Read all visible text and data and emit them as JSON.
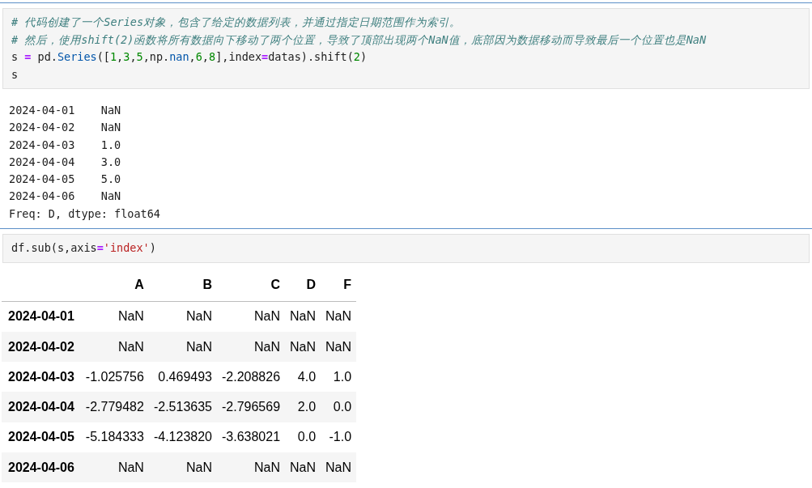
{
  "cells": [
    {
      "input": {
        "lines": [
          [
            {
              "kind": "comment",
              "text": "# 代码创建了一个Series对象，包含了给定的数据列表，并通过指定日期范围作为索引。"
            }
          ],
          [
            {
              "kind": "comment",
              "text": "# 然后，使用shift(2)函数将所有数据向下移动了两个位置，导致了顶部出现两个NaN值，底部因为数据移动而导致最后一个位置也是NaN"
            }
          ],
          [
            {
              "kind": "text",
              "text": "s "
            },
            {
              "kind": "operator",
              "text": "="
            },
            {
              "kind": "text",
              "text": " pd."
            },
            {
              "kind": "name",
              "text": "Series"
            },
            {
              "kind": "text",
              "text": "(["
            },
            {
              "kind": "number",
              "text": "1"
            },
            {
              "kind": "text",
              "text": ","
            },
            {
              "kind": "number",
              "text": "3"
            },
            {
              "kind": "text",
              "text": ","
            },
            {
              "kind": "number",
              "text": "5"
            },
            {
              "kind": "text",
              "text": ",np."
            },
            {
              "kind": "name",
              "text": "nan"
            },
            {
              "kind": "text",
              "text": ","
            },
            {
              "kind": "number",
              "text": "6"
            },
            {
              "kind": "text",
              "text": ","
            },
            {
              "kind": "number",
              "text": "8"
            },
            {
              "kind": "text",
              "text": "],index"
            },
            {
              "kind": "operator",
              "text": "="
            },
            {
              "kind": "text",
              "text": "datas).shift("
            },
            {
              "kind": "number",
              "text": "2"
            },
            {
              "kind": "text",
              "text": ")"
            }
          ],
          [
            {
              "kind": "text",
              "text": "s"
            }
          ]
        ]
      },
      "output": {
        "kind": "stream",
        "lines": [
          "2024-04-01    NaN",
          "2024-04-02    NaN",
          "2024-04-03    1.0",
          "2024-04-04    3.0",
          "2024-04-05    5.0",
          "2024-04-06    NaN",
          "Freq: D, dtype: float64"
        ]
      }
    },
    {
      "input": {
        "lines": [
          [
            {
              "kind": "text",
              "text": "df.sub(s,axis"
            },
            {
              "kind": "operator",
              "text": "="
            },
            {
              "kind": "string",
              "text": "'index'"
            },
            {
              "kind": "text",
              "text": ")"
            }
          ]
        ]
      },
      "output": {
        "kind": "table",
        "columns": [
          "A",
          "B",
          "C",
          "D",
          "F"
        ],
        "rows": [
          {
            "index": "2024-04-01",
            "values": [
              "NaN",
              "NaN",
              "NaN",
              "NaN",
              "NaN"
            ]
          },
          {
            "index": "2024-04-02",
            "values": [
              "NaN",
              "NaN",
              "NaN",
              "NaN",
              "NaN"
            ]
          },
          {
            "index": "2024-04-03",
            "values": [
              "-1.025756",
              "0.469493",
              "-2.208826",
              "4.0",
              "1.0"
            ]
          },
          {
            "index": "2024-04-04",
            "values": [
              "-2.779482",
              "-2.513635",
              "-2.796569",
              "2.0",
              "0.0"
            ]
          },
          {
            "index": "2024-04-05",
            "values": [
              "-5.184333",
              "-4.123820",
              "-3.638021",
              "0.0",
              "-1.0"
            ]
          },
          {
            "index": "2024-04-06",
            "values": [
              "NaN",
              "NaN",
              "NaN",
              "NaN",
              "NaN"
            ]
          }
        ]
      }
    }
  ]
}
